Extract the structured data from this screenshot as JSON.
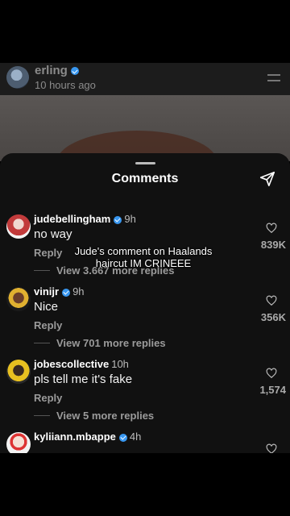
{
  "post": {
    "username": "erling",
    "timestamp": "10 hours ago"
  },
  "sheet": {
    "title": "Comments"
  },
  "overlay_caption": "Jude's comment on Haalands haircut IM CRINEEE",
  "comments": [
    {
      "username": "judebellingham",
      "time": "9h",
      "text": "no way",
      "reply_label": "Reply",
      "view_replies": "View 3.667 more replies",
      "likes": "839K"
    },
    {
      "username": "vinijr",
      "time": "9h",
      "text": "Nice",
      "reply_label": "Reply",
      "view_replies": "View 701 more replies",
      "likes": "356K"
    },
    {
      "username": "jobescollective",
      "time": "10h",
      "text": "pls tell me it's fake",
      "reply_label": "Reply",
      "view_replies": "View 5 more replies",
      "likes": "1,574"
    },
    {
      "username": "kyliiann.mbappe",
      "time": "4h"
    }
  ],
  "icons": {
    "verified": "verified-badge-icon",
    "menu": "menu-icon",
    "share": "send-icon",
    "like": "heart-icon"
  },
  "colors": {
    "verified": "#3897f0",
    "sheet_bg": "#111111",
    "secondary_text": "#9b9b9b"
  }
}
